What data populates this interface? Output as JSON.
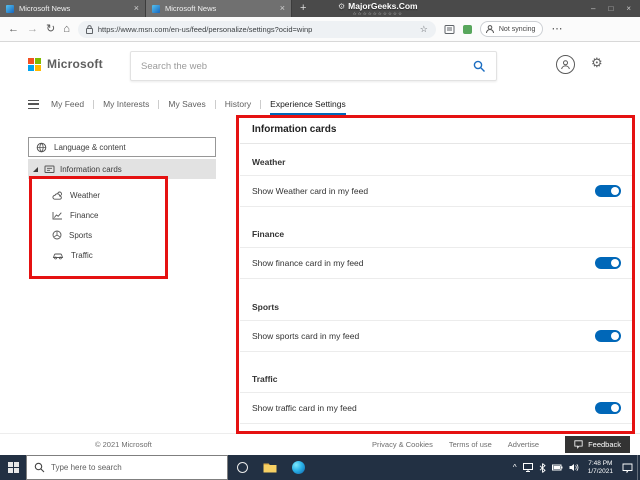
{
  "colors": {
    "accent": "#0067b8",
    "toggle_on": "#0067b8",
    "annotation": "#e51111"
  },
  "icons": {
    "back": "←",
    "forward": "→",
    "refresh": "↻",
    "home": "⌂",
    "star": "☆",
    "more": "⋯",
    "gear": "⚙",
    "plus": "+",
    "close": "×",
    "minimize": "–",
    "maximize": "□",
    "chevron_up": "^"
  },
  "browser": {
    "tabs": [
      {
        "title": "Microsoft News"
      },
      {
        "title": "Microsoft News"
      }
    ],
    "watermark": {
      "title": "MajorGeeks.Com",
      "stars": "☆☆☆☆☆☆☆☆☆☆"
    },
    "url": "https://www.msn.com/en-us/feed/personalize/settings?ocid=winp",
    "not_syncing_label": "Not syncing"
  },
  "msn_header": {
    "brand": "Microsoft",
    "search_placeholder": "Search the web"
  },
  "nav": {
    "items": [
      {
        "label": "My Feed",
        "active": false
      },
      {
        "label": "My Interests",
        "active": false
      },
      {
        "label": "My Saves",
        "active": false
      },
      {
        "label": "History",
        "active": false
      },
      {
        "label": "Experience Settings",
        "active": true
      }
    ]
  },
  "sidebar": {
    "items": [
      {
        "label": "Language & content"
      },
      {
        "label": "Information cards"
      }
    ],
    "subitems": [
      {
        "label": "Weather"
      },
      {
        "label": "Finance"
      },
      {
        "label": "Sports"
      },
      {
        "label": "Traffic"
      }
    ]
  },
  "main": {
    "title": "Information cards",
    "sections": [
      {
        "heading": "Weather",
        "toggle_label": "Show Weather card in my feed",
        "on": true
      },
      {
        "heading": "Finance",
        "toggle_label": "Show finance card in my feed",
        "on": true
      },
      {
        "heading": "Sports",
        "toggle_label": "Show sports card in my feed",
        "on": true
      },
      {
        "heading": "Traffic",
        "toggle_label": "Show traffic card in my feed",
        "on": true
      }
    ]
  },
  "footer": {
    "copyright": "© 2021 Microsoft",
    "links": [
      {
        "label": "Privacy & Cookies"
      },
      {
        "label": "Terms of use"
      },
      {
        "label": "Advertise"
      }
    ],
    "feedback_label": "Feedback"
  },
  "taskbar": {
    "search_placeholder": "Type here to search",
    "time": "7:48 PM",
    "date": "1/7/2021"
  }
}
